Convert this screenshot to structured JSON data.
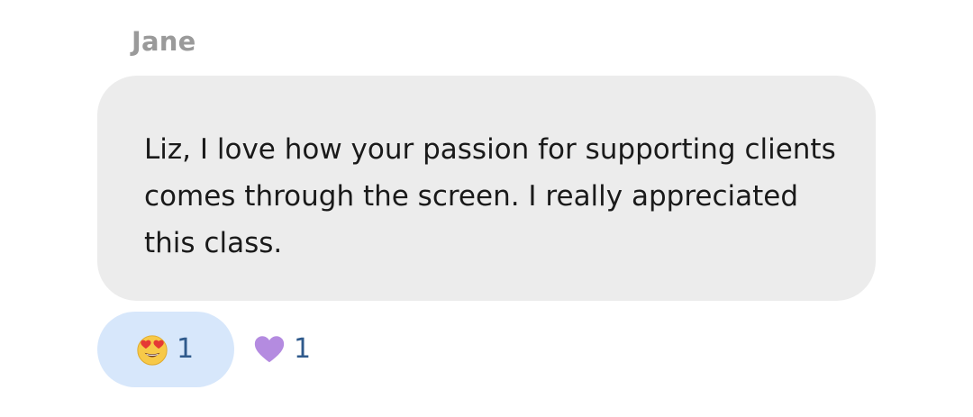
{
  "message": {
    "sender": "Jane",
    "text": "Liz, I love how your passion for supporting clients\ncomes through the screen. I really appreciated\nthis class."
  },
  "reactions": [
    {
      "icon": "heart-eyes-emoji-icon",
      "count": "1",
      "selected": true
    },
    {
      "icon": "purple-heart-icon",
      "count": "1",
      "selected": false
    }
  ],
  "colors": {
    "bubble": "#ececec",
    "selected_reaction_bg": "#d7e7fb",
    "sender_name": "#9a9a9a",
    "count_text": "#2f5a8c",
    "purple_heart": "#b48be0"
  }
}
